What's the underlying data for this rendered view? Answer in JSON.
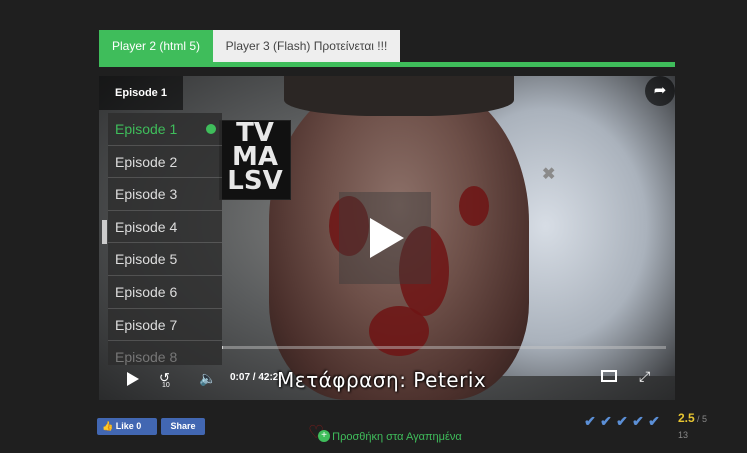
{
  "tabs": [
    {
      "label": "Player 2 (html 5)",
      "active": true
    },
    {
      "label": "Player 3 (Flash) Προτείνεται !!!",
      "active": false
    }
  ],
  "accent_color": "#3fbd5b",
  "player": {
    "episode_button": "Episode 1",
    "rating_badge": [
      "TV",
      "MA",
      "LSV"
    ],
    "episodes": [
      "Episode 1",
      "Episode 2",
      "Episode 3",
      "Episode 4",
      "Episode 5",
      "Episode 6",
      "Episode 7",
      "Episode 8"
    ],
    "active_episode": "Episode 1",
    "time_current": "0:07",
    "time_total": "/ 42:23",
    "rewind_seconds": "10",
    "subtitle": "Μετάφραση: Peterix",
    "progress_fraction": 0.0028
  },
  "social": {
    "like_label": "Like 0",
    "share_label": "Share"
  },
  "favorites": {
    "label": "Προσθήκη στα Αγαπημένα"
  },
  "rating": {
    "stars": 5,
    "score": "2.5",
    "max": "/ 5",
    "votes": "13"
  }
}
